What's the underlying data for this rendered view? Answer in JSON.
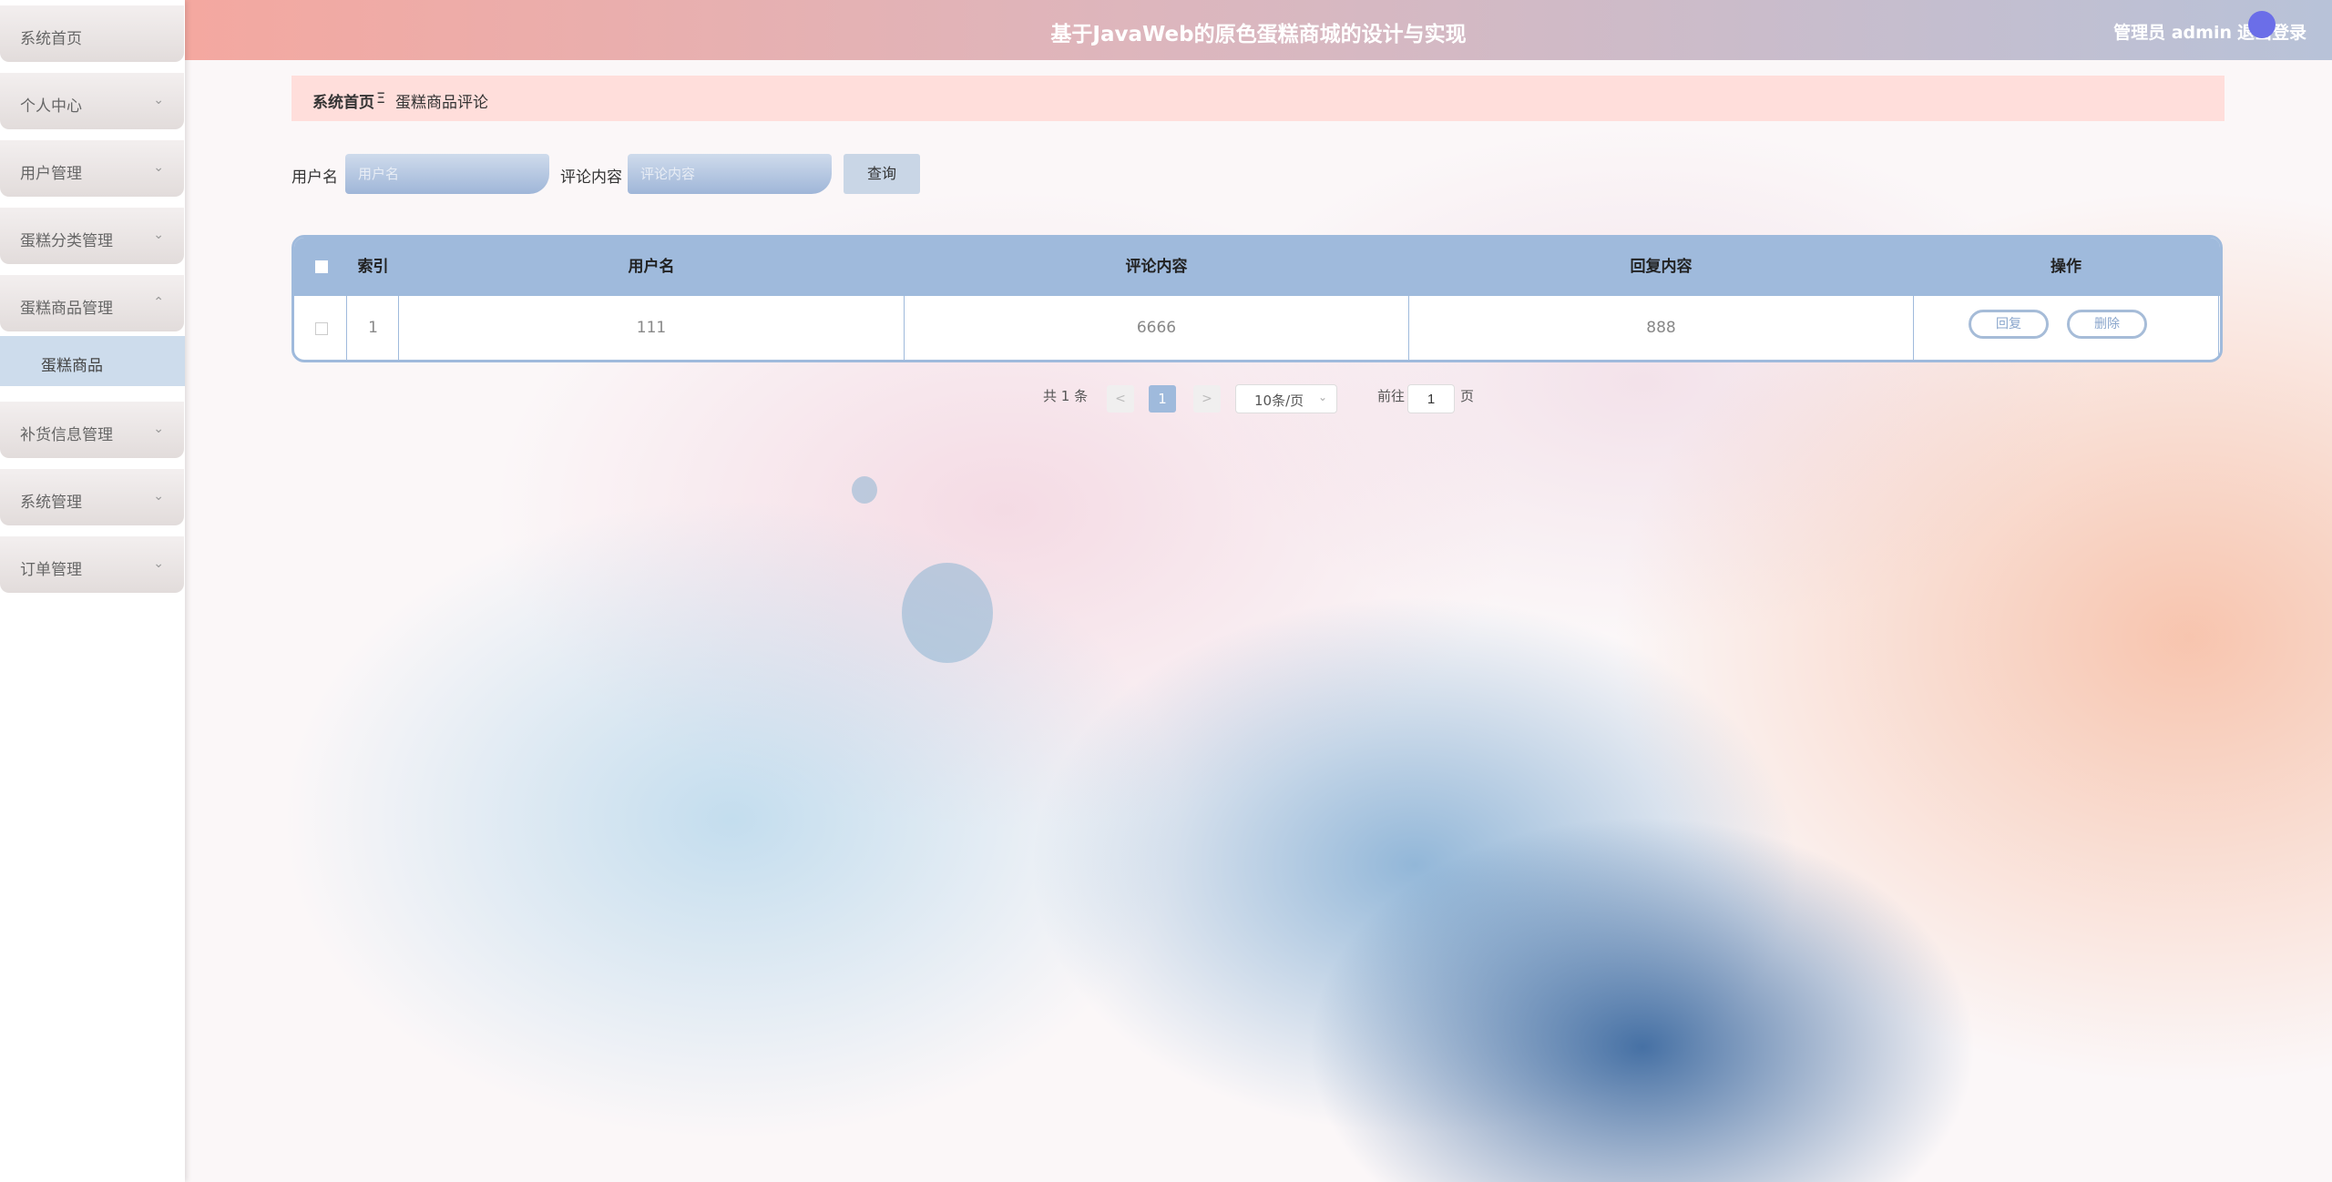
{
  "header": {
    "title": "基于JavaWeb的原色蛋糕商城的设计与实现",
    "admin_label": "管理员 admin",
    "logout_label": "退出登录"
  },
  "sidebar": {
    "items": [
      {
        "label": "系统首页",
        "chevron": ""
      },
      {
        "label": "个人中心",
        "chevron": "⌄"
      },
      {
        "label": "用户管理",
        "chevron": "⌄"
      },
      {
        "label": "蛋糕分类管理",
        "chevron": "⌄"
      },
      {
        "label": "蛋糕商品管理",
        "chevron": "⌃"
      },
      {
        "label": "补货信息管理",
        "chevron": "⌄"
      },
      {
        "label": "系统管理",
        "chevron": "⌄"
      },
      {
        "label": "订单管理",
        "chevron": "⌄"
      }
    ],
    "submenu_label": "蛋糕商品"
  },
  "breadcrumb": {
    "home": "系统首页",
    "separator": "Ξ",
    "current": "蛋糕商品评论"
  },
  "search": {
    "username_label": "用户名",
    "username_placeholder": "用户名",
    "comment_label": "评论内容",
    "comment_placeholder": "评论内容",
    "query_button": "查询"
  },
  "table": {
    "headers": {
      "index": "索引",
      "username": "用户名",
      "comment": "评论内容",
      "reply": "回复内容",
      "actions": "操作"
    },
    "rows": [
      {
        "index": "1",
        "username": "111",
        "comment": "6666",
        "reply": "888",
        "reply_btn": "回复",
        "delete_btn": "删除"
      }
    ]
  },
  "pagination": {
    "total": "共 1 条",
    "prev": "<",
    "current_page": "1",
    "next": ">",
    "page_size": "10条/页",
    "goto_label": "前往",
    "goto_value": "1",
    "page_suffix": "页"
  },
  "colors": {
    "accent": "#9fbadc",
    "breadcrumb_bg": "#ffdedb",
    "header_start": "#f4a8a0",
    "header_end": "#b8c2d8"
  }
}
